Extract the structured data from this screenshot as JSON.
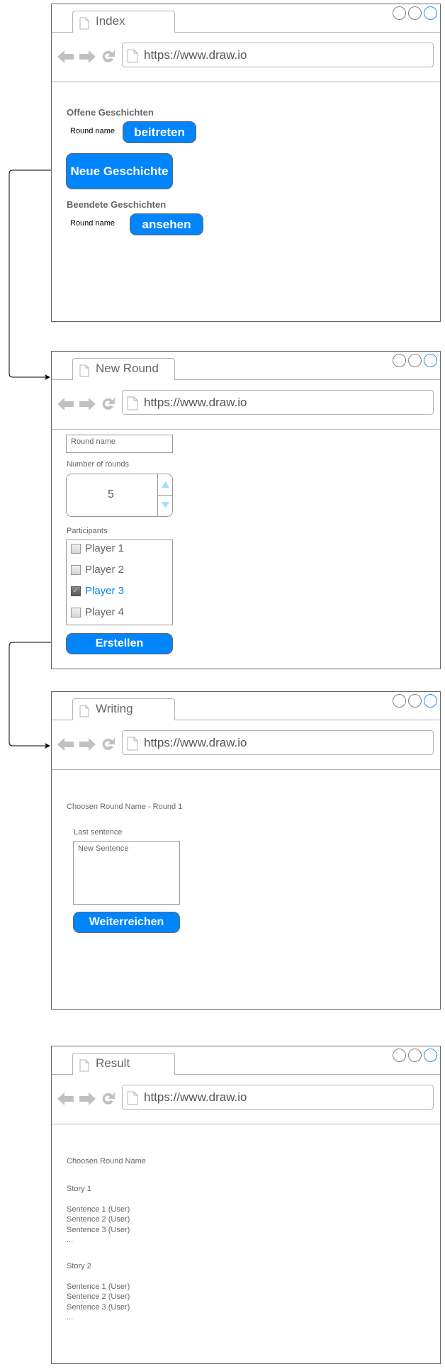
{
  "windows": {
    "index": {
      "tab_title": "Index",
      "url": "https://www.draw.io",
      "open_heading": "Offene Geschichten",
      "open_round_name": "Round name",
      "join_button": "beitreten",
      "new_story_button": "Neue Geschichte",
      "finished_heading": "Beendete Geschichten",
      "finished_round_name": "Round name",
      "view_button": "ansehen"
    },
    "new_round": {
      "tab_title": "New Round",
      "url": "https://www.draw.io",
      "round_name_placeholder": "Round name",
      "rounds_label": "Number of rounds",
      "rounds_value": "5",
      "participants_label": "Participants",
      "participants": [
        {
          "label": "Player 1",
          "checked": false
        },
        {
          "label": "Player 2",
          "checked": false
        },
        {
          "label": "Player 3",
          "checked": true
        },
        {
          "label": "Player 4",
          "checked": false
        }
      ],
      "create_button": "Erstellen"
    },
    "writing": {
      "tab_title": "Writing",
      "url": "https://www.draw.io",
      "round_title": "Choosen Round Name - Round 1",
      "last_sentence_label": "Last sentence",
      "sentence_placeholder": "New Sentence",
      "pass_button": "Weiterreichen"
    },
    "result": {
      "tab_title": "Result",
      "url": "https://www.draw.io",
      "round_title": "Choosen Round Name",
      "stories": [
        {
          "title": "Story 1",
          "sentences": [
            "Sentence 1 (User)",
            "Sentence 2 (User)",
            "Sentence 3 (User)",
            "..."
          ]
        },
        {
          "title": "Story 2",
          "sentences": [
            "Sentence 1 (User)",
            "Sentence 2 (User)",
            "Sentence 3 (User)",
            "..."
          ]
        }
      ]
    }
  },
  "colors": {
    "accent": "#0085fc",
    "border": "#666666",
    "muted_text": "#666666"
  }
}
